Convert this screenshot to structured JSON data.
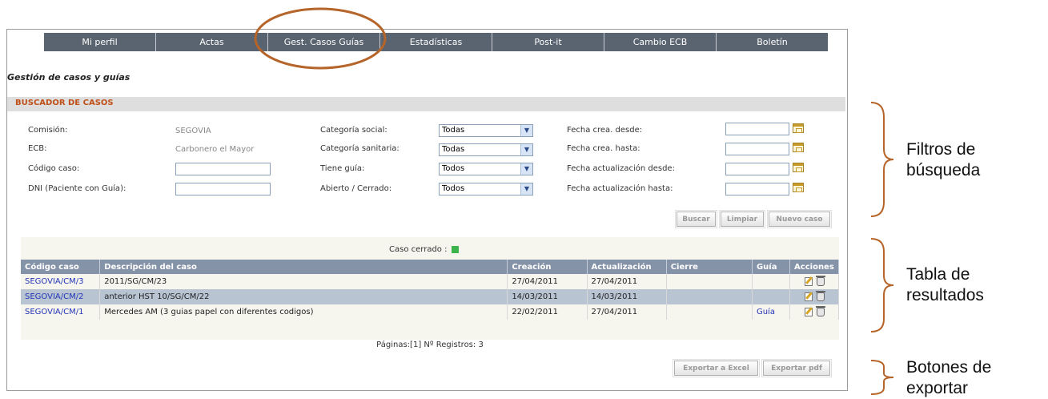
{
  "nav": [
    "Mi perfil",
    "Actas",
    "Gest. Casos Guías",
    "Estadísticas",
    "Post-it",
    "Cambio ECB",
    "Boletín"
  ],
  "heading": "Gestión de casos y guías",
  "section_title": "BUSCADOR DE CASOS",
  "filters": {
    "comision_label": "Comisión:",
    "comision_value": "SEGOVIA",
    "ecb_label": "ECB:",
    "ecb_value": "Carbonero el Mayor",
    "codigo_label": "Código caso:",
    "codigo_value": "",
    "dni_label": "DNI (Paciente con Guía):",
    "dni_value": "",
    "cat_social_label": "Categoría social:",
    "cat_social_value": "Todas",
    "cat_sanitaria_label": "Categoría sanitaria:",
    "cat_sanitaria_value": "Todas",
    "tiene_guia_label": "Tiene guía:",
    "tiene_guia_value": "Todos",
    "abierto_label": "Abierto / Cerrado:",
    "abierto_value": "Todos",
    "fecha_crea_desde_label": "Fecha crea. desde:",
    "fecha_crea_hasta_label": "Fecha crea. hasta:",
    "fecha_act_desde_label": "Fecha actualización desde:",
    "fecha_act_hasta_label": "Fecha actualización hasta:"
  },
  "buttons": {
    "buscar": "Buscar",
    "limpiar": "Limpiar",
    "nuevo": "Nuevo caso",
    "excel": "Exportar a Excel",
    "pdf": "Exportar pdf"
  },
  "legend": "Caso cerrado :",
  "table": {
    "headers": [
      "Código caso",
      "Descripción del caso",
      "Creación",
      "Actualización",
      "Cierre",
      "Guía",
      "Acciones"
    ],
    "rows": [
      {
        "codigo": "SEGOVIA/CM/3",
        "descripcion": "2011/SG/CM/23",
        "creacion": "27/04/2011",
        "actualizacion": "27/04/2011",
        "cierre": "",
        "guia": ""
      },
      {
        "codigo": "SEGOVIA/CM/2",
        "descripcion": "anterior HST 10/SG/CM/22",
        "creacion": "14/03/2011",
        "actualizacion": "14/03/2011",
        "cierre": "",
        "guia": ""
      },
      {
        "codigo": "SEGOVIA/CM/1",
        "descripcion": "Mercedes AM (3 guias papel con diferentes codigos)",
        "creacion": "22/02/2011",
        "actualizacion": "27/04/2011",
        "cierre": "",
        "guia": "Guía"
      }
    ]
  },
  "pagination": "Páginas:[1]   Nº Registros: 3",
  "callouts": {
    "filtros": [
      "Filtros de",
      "búsqueda"
    ],
    "tabla": [
      "Tabla de",
      "resultados"
    ],
    "botones": [
      "Botones de",
      "exportar"
    ]
  },
  "colors": {
    "accent": "#c0501a",
    "nav": "#5a6470",
    "header": "#8593a8",
    "bracket": "#b5652a"
  }
}
